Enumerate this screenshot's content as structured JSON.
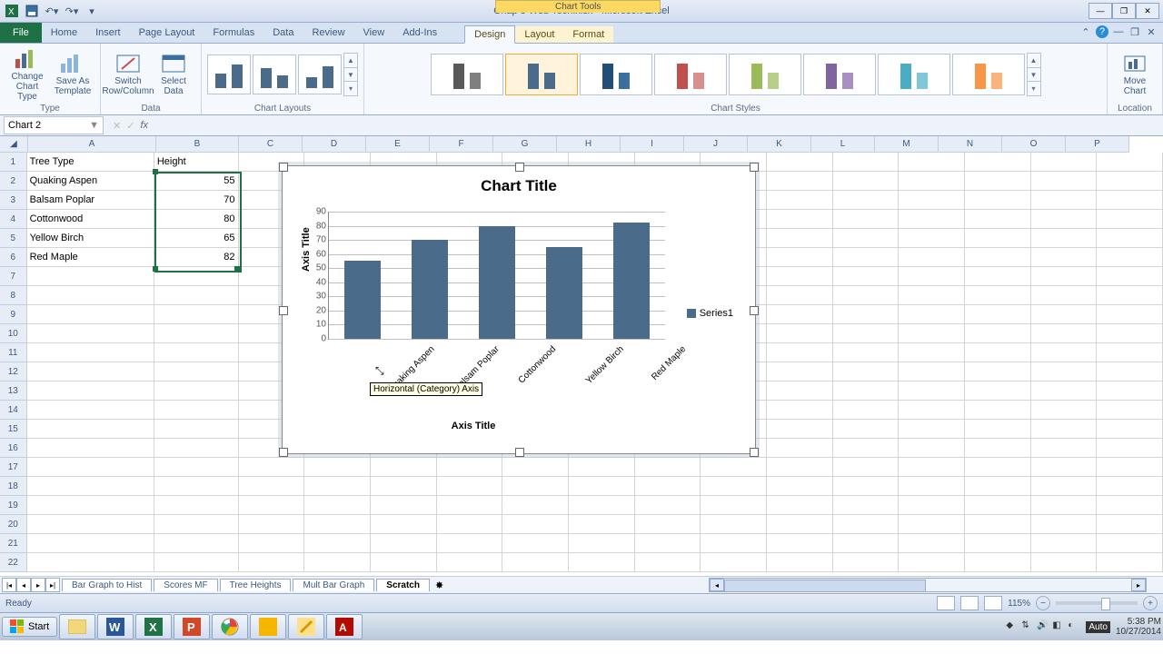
{
  "app": {
    "filename": "Chap 3 Web Tech.xlsx",
    "appname": "Microsoft Excel",
    "title_sep": " - ",
    "context_group": "Chart Tools"
  },
  "tabs": {
    "file": "File",
    "list": [
      "Home",
      "Insert",
      "Page Layout",
      "Formulas",
      "Data",
      "Review",
      "View",
      "Add-Ins"
    ],
    "context": [
      "Design",
      "Layout",
      "Format"
    ],
    "active": "Design"
  },
  "ribbon": {
    "groups": {
      "type": "Type",
      "data": "Data",
      "layouts": "Chart Layouts",
      "styles": "Chart Styles",
      "location": "Location"
    },
    "buttons": {
      "change_type": "Change Chart Type",
      "save_template": "Save As Template",
      "switch": "Switch Row/Column",
      "select_data": "Select Data",
      "move_chart": "Move Chart"
    }
  },
  "namebox": "Chart 2",
  "sheet": {
    "headers": {
      "a": "Tree Type",
      "b": "Height"
    },
    "rows": [
      {
        "a": "Quaking Aspen",
        "b": "55"
      },
      {
        "a": "Balsam Poplar",
        "b": "70"
      },
      {
        "a": "Cottonwood",
        "b": "80"
      },
      {
        "a": "Yellow Birch",
        "b": "65"
      },
      {
        "a": "Red Maple",
        "b": "82"
      }
    ],
    "cols": [
      "A",
      "B",
      "C",
      "D",
      "E",
      "F",
      "G",
      "H",
      "I",
      "J",
      "K",
      "L",
      "M",
      "N",
      "O",
      "P"
    ]
  },
  "chart_data": {
    "type": "bar",
    "title": "Chart Title",
    "xlabel": "Axis Title",
    "ylabel": "Axis Title",
    "categories": [
      "Quaking Aspen",
      "Balsam Poplar",
      "Cottonwood",
      "Yellow Birch",
      "Red Maple"
    ],
    "series": [
      {
        "name": "Series1",
        "values": [
          55,
          70,
          80,
          65,
          82
        ]
      }
    ],
    "ylim": [
      0,
      90
    ],
    "yticks": [
      0,
      10,
      20,
      30,
      40,
      50,
      60,
      70,
      80,
      90
    ],
    "tooltip": "Horizontal (Category) Axis"
  },
  "style_palette": [
    [
      "#595959",
      "#7f7f7f"
    ],
    [
      "#4a6b8a",
      "#4a6b8a"
    ],
    [
      "#1f4e79",
      "#3b6fa0"
    ],
    [
      "#c0504d",
      "#d98f8d"
    ],
    [
      "#9bbb59",
      "#b7cf87"
    ],
    [
      "#8064a2",
      "#a990c4"
    ],
    [
      "#4bacc6",
      "#7fc7d9"
    ],
    [
      "#f79646",
      "#fab37a"
    ]
  ],
  "sheet_tabs": [
    "Bar Graph to Hist",
    "Scores MF",
    "Tree Heights",
    "Mult Bar Graph",
    "Scratch"
  ],
  "active_sheet": "Scratch",
  "status": {
    "ready": "Ready",
    "zoom": "115%"
  },
  "taskbar": {
    "start": "Start",
    "time": "5:38 PM",
    "date": "10/27/2014",
    "auto": "Auto"
  }
}
